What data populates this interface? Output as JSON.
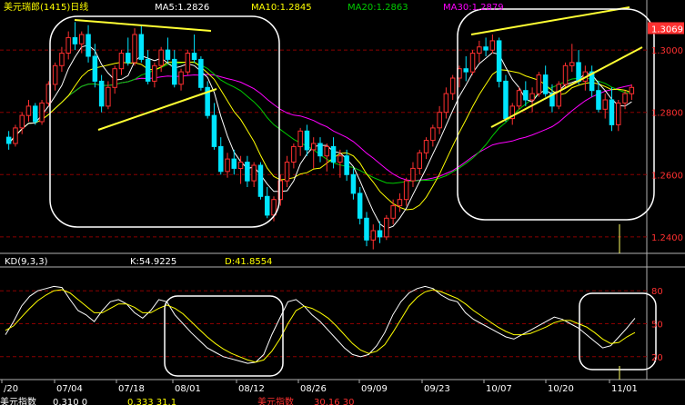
{
  "header": {
    "title": "美元瑞郎(1415)日线",
    "ma5": "MA5:1.2826",
    "ma10": "MA10:1.2845",
    "ma20": "MA20:1.2863",
    "ma30": "MA30:1.2879"
  },
  "kd_panel": {
    "title": "KD(9,3,3)",
    "k_value": "K:54.9225",
    "d_value": "D:41.8554"
  },
  "bottom_bar": {
    "left": "美元指数",
    "left_value": "0.310 0",
    "mid_value": "0.333 31.1",
    "right": "美元指数",
    "right_value": "30.16 30"
  },
  "colors": {
    "up_candle": "#ff3030",
    "down_candle": "#00e5ff",
    "ma5": "#ffffff",
    "ma10": "#ffff00",
    "ma20": "#00cc00",
    "ma30": "#ff00ff",
    "k_line": "#ffffff",
    "d_line": "#ffff00",
    "trendline": "#ffff33",
    "grid": "#8b0000"
  },
  "chart_data": [
    {
      "type": "candlestick",
      "title": "美元瑞郎(1415)日线",
      "x_ticks": [
        "/20",
        "07/04",
        "07/18",
        "08/01",
        "08/12",
        "08/26",
        "09/09",
        "09/23",
        "10/07",
        "10/20",
        "11/01"
      ],
      "y_ticks": [
        "1.3000",
        "1.2800",
        "1.2600",
        "1.2400"
      ],
      "y_top_label": "1.3069",
      "ylim": [
        1.235,
        1.312
      ],
      "grid": true,
      "candles": [
        [
          1.272,
          1.274,
          1.268,
          1.27
        ],
        [
          1.27,
          1.276,
          1.269,
          1.275
        ],
        [
          1.275,
          1.28,
          1.273,
          1.279
        ],
        [
          1.279,
          1.284,
          1.277,
          1.282
        ],
        [
          1.282,
          1.283,
          1.276,
          1.277
        ],
        [
          1.277,
          1.284,
          1.276,
          1.283
        ],
        [
          1.283,
          1.29,
          1.282,
          1.289
        ],
        [
          1.289,
          1.296,
          1.287,
          1.295
        ],
        [
          1.295,
          1.301,
          1.293,
          1.299
        ],
        [
          1.299,
          1.306,
          1.297,
          1.304
        ],
        [
          1.304,
          1.309,
          1.3,
          1.302
        ],
        [
          1.302,
          1.306,
          1.299,
          1.305
        ],
        [
          1.305,
          1.308,
          1.296,
          1.298
        ],
        [
          1.298,
          1.302,
          1.288,
          1.29
        ],
        [
          1.29,
          1.292,
          1.28,
          1.282
        ],
        [
          1.282,
          1.29,
          1.281,
          1.288
        ],
        [
          1.288,
          1.295,
          1.286,
          1.294
        ],
        [
          1.294,
          1.3,
          1.292,
          1.299
        ],
        [
          1.299,
          1.304,
          1.295,
          1.296
        ],
        [
          1.296,
          1.307,
          1.295,
          1.305
        ],
        [
          1.305,
          1.308,
          1.296,
          1.297
        ],
        [
          1.297,
          1.3,
          1.289,
          1.29
        ],
        [
          1.29,
          1.296,
          1.288,
          1.295
        ],
        [
          1.295,
          1.301,
          1.293,
          1.3
        ],
        [
          1.3,
          1.304,
          1.296,
          1.297
        ],
        [
          1.297,
          1.3,
          1.288,
          1.289
        ],
        [
          1.289,
          1.294,
          1.287,
          1.293
        ],
        [
          1.293,
          1.3,
          1.292,
          1.299
        ],
        [
          1.299,
          1.305,
          1.296,
          1.297
        ],
        [
          1.297,
          1.298,
          1.287,
          1.288
        ],
        [
          1.288,
          1.29,
          1.278,
          1.279
        ],
        [
          1.279,
          1.283,
          1.268,
          1.269
        ],
        [
          1.269,
          1.272,
          1.26,
          1.261
        ],
        [
          1.261,
          1.267,
          1.259,
          1.265
        ],
        [
          1.265,
          1.268,
          1.26,
          1.262
        ],
        [
          1.262,
          1.266,
          1.257,
          1.264
        ],
        [
          1.264,
          1.266,
          1.256,
          1.258
        ],
        [
          1.258,
          1.264,
          1.256,
          1.263
        ],
        [
          1.263,
          1.264,
          1.252,
          1.253
        ],
        [
          1.253,
          1.256,
          1.246,
          1.247
        ],
        [
          1.247,
          1.253,
          1.245,
          1.252
        ],
        [
          1.252,
          1.26,
          1.25,
          1.258
        ],
        [
          1.258,
          1.266,
          1.256,
          1.264
        ],
        [
          1.264,
          1.27,
          1.262,
          1.269
        ],
        [
          1.269,
          1.275,
          1.266,
          1.274
        ],
        [
          1.274,
          1.276,
          1.266,
          1.268
        ],
        [
          1.268,
          1.272,
          1.262,
          1.27
        ],
        [
          1.27,
          1.272,
          1.264,
          1.266
        ],
        [
          1.266,
          1.27,
          1.261,
          1.269
        ],
        [
          1.269,
          1.272,
          1.262,
          1.264
        ],
        [
          1.264,
          1.268,
          1.259,
          1.266
        ],
        [
          1.266,
          1.268,
          1.258,
          1.26
        ],
        [
          1.26,
          1.262,
          1.252,
          1.254
        ],
        [
          1.254,
          1.256,
          1.244,
          1.246
        ],
        [
          1.246,
          1.248,
          1.237,
          1.239
        ],
        [
          1.239,
          1.244,
          1.236,
          1.242
        ],
        [
          1.242,
          1.245,
          1.238,
          1.24
        ],
        [
          1.24,
          1.247,
          1.239,
          1.246
        ],
        [
          1.246,
          1.252,
          1.244,
          1.25
        ],
        [
          1.25,
          1.254,
          1.248,
          1.252
        ],
        [
          1.252,
          1.259,
          1.25,
          1.258
        ],
        [
          1.258,
          1.264,
          1.256,
          1.262
        ],
        [
          1.262,
          1.268,
          1.26,
          1.267
        ],
        [
          1.267,
          1.272,
          1.265,
          1.271
        ],
        [
          1.271,
          1.276,
          1.269,
          1.275
        ],
        [
          1.275,
          1.282,
          1.273,
          1.28
        ],
        [
          1.28,
          1.288,
          1.278,
          1.286
        ],
        [
          1.286,
          1.292,
          1.284,
          1.291
        ],
        [
          1.291,
          1.295,
          1.288,
          1.294
        ],
        [
          1.294,
          1.298,
          1.29,
          1.293
        ],
        [
          1.293,
          1.3,
          1.292,
          1.299
        ],
        [
          1.299,
          1.303,
          1.296,
          1.301
        ],
        [
          1.301,
          1.304,
          1.298,
          1.3
        ],
        [
          1.3,
          1.305,
          1.299,
          1.303
        ],
        [
          1.303,
          1.304,
          1.288,
          1.29
        ],
        [
          1.29,
          1.292,
          1.277,
          1.278
        ],
        [
          1.278,
          1.283,
          1.276,
          1.282
        ],
        [
          1.282,
          1.288,
          1.281,
          1.287
        ],
        [
          1.287,
          1.29,
          1.282,
          1.284
        ],
        [
          1.284,
          1.288,
          1.28,
          1.286
        ],
        [
          1.286,
          1.293,
          1.285,
          1.292
        ],
        [
          1.292,
          1.295,
          1.285,
          1.286
        ],
        [
          1.286,
          1.289,
          1.28,
          1.282
        ],
        [
          1.282,
          1.29,
          1.281,
          1.289
        ],
        [
          1.289,
          1.296,
          1.288,
          1.295
        ],
        [
          1.295,
          1.302,
          1.293,
          1.296
        ],
        [
          1.296,
          1.3,
          1.289,
          1.29
        ],
        [
          1.29,
          1.295,
          1.287,
          1.293
        ],
        [
          1.293,
          1.295,
          1.285,
          1.287
        ],
        [
          1.287,
          1.29,
          1.28,
          1.281
        ],
        [
          1.281,
          1.286,
          1.278,
          1.284
        ],
        [
          1.284,
          1.288,
          1.274,
          1.276
        ],
        [
          1.276,
          1.284,
          1.274,
          1.283
        ],
        [
          1.283,
          1.287,
          1.281,
          1.286
        ],
        [
          1.286,
          1.289,
          1.284,
          1.288
        ]
      ],
      "ma_current": {
        "MA5": 1.2826,
        "MA10": 1.2845,
        "MA20": 1.2863,
        "MA30": 1.2879
      }
    },
    {
      "type": "line",
      "title": "KD(9,3,3)",
      "y_ticks": [
        "80",
        "50",
        "20"
      ],
      "ylim": [
        0,
        100
      ],
      "x_ticks": [
        "/20",
        "07/04",
        "07/18",
        "08/01",
        "08/12",
        "08/26",
        "09/09",
        "09/23",
        "10/07",
        "10/20",
        "11/01"
      ],
      "series": [
        {
          "name": "K",
          "value_label": "K:54.9225",
          "values": [
            40,
            52,
            66,
            75,
            80,
            82,
            84,
            83,
            72,
            62,
            58,
            52,
            62,
            70,
            72,
            68,
            60,
            55,
            62,
            72,
            70,
            58,
            50,
            42,
            35,
            28,
            24,
            20,
            18,
            16,
            14,
            15,
            22,
            40,
            55,
            70,
            72,
            66,
            58,
            52,
            44,
            36,
            28,
            22,
            20,
            22,
            30,
            42,
            58,
            70,
            78,
            82,
            84,
            82,
            76,
            72,
            70,
            60,
            54,
            50,
            46,
            42,
            38,
            36,
            40,
            44,
            48,
            52,
            56,
            54,
            50,
            46,
            40,
            34,
            28,
            30,
            38,
            46,
            55
          ]
        },
        {
          "name": "D",
          "value_label": "D:41.8554",
          "values": [
            44,
            48,
            56,
            64,
            71,
            76,
            80,
            81,
            78,
            72,
            66,
            60,
            60,
            64,
            68,
            68,
            65,
            60,
            60,
            64,
            67,
            64,
            59,
            52,
            45,
            38,
            32,
            27,
            23,
            20,
            17,
            15,
            17,
            25,
            36,
            50,
            62,
            66,
            64,
            60,
            55,
            48,
            40,
            32,
            26,
            23,
            25,
            31,
            42,
            54,
            66,
            74,
            79,
            81,
            79,
            76,
            73,
            68,
            62,
            57,
            52,
            47,
            43,
            40,
            40,
            41,
            44,
            47,
            51,
            53,
            53,
            50,
            47,
            42,
            36,
            32,
            33,
            38,
            42
          ]
        }
      ]
    }
  ]
}
